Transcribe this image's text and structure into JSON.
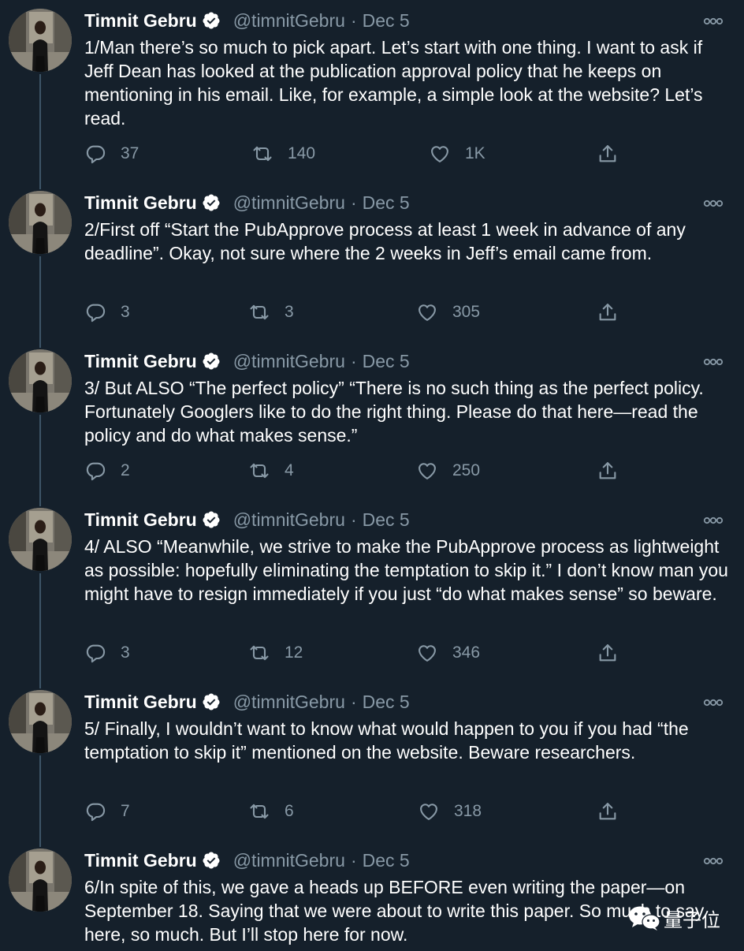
{
  "colors": {
    "background": "#15202b",
    "text": "#ffffff",
    "secondary": "#8899a6",
    "verified": "#ffffff",
    "thread_line": "#3d5466"
  },
  "author": {
    "name": "Timnit Gebru",
    "handle": "@timnitGebru",
    "separator": "·"
  },
  "tweets": [
    {
      "date": "Dec 5",
      "text": "1/Man there’s so much to pick apart. Let’s start with one thing. I want to ask if Jeff Dean has looked at the publication approval policy that he keeps on mentioning in his email. Like, for example, a simple look at the website? Let’s read.",
      "replies": "37",
      "retweets": "140",
      "likes": "1K"
    },
    {
      "date": "Dec 5",
      "text": "2/First off “Start the PubApprove process at least 1 week in advance of any deadline”. Okay, not sure where the 2 weeks in Jeff’s email came from.",
      "replies": "3",
      "retweets": "3",
      "likes": "305"
    },
    {
      "date": "Dec 5",
      "text": "3/ But ALSO “The perfect policy” “There is no such thing as the perfect policy. Fortunately Googlers like to do the right thing. Please do that here—read the policy and do what makes sense.”",
      "replies": "2",
      "retweets": "4",
      "likes": "250"
    },
    {
      "date": "Dec 5",
      "text": "4/ ALSO “Meanwhile, we strive to make the PubApprove process as lightweight as possible: hopefully eliminating the temptation to skip it.” I don’t know man you might have to resign immediately if you just “do what makes sense” so beware.",
      "replies": "3",
      "retweets": "12",
      "likes": "346"
    },
    {
      "date": "Dec 5",
      "text": "5/ Finally, I wouldn’t want to know what would happen to you if you had “the temptation to skip it” mentioned on the website. Beware researchers.",
      "replies": "7",
      "retweets": "6",
      "likes": "318"
    },
    {
      "date": "Dec 5",
      "text": "6/In spite of this, we gave a heads up BEFORE even writing the paper—on September 18. Saying that we were about to write this paper. So much to say here, so much. But I’ll stop here for now."
    }
  ],
  "watermark": {
    "text": "量子位"
  }
}
